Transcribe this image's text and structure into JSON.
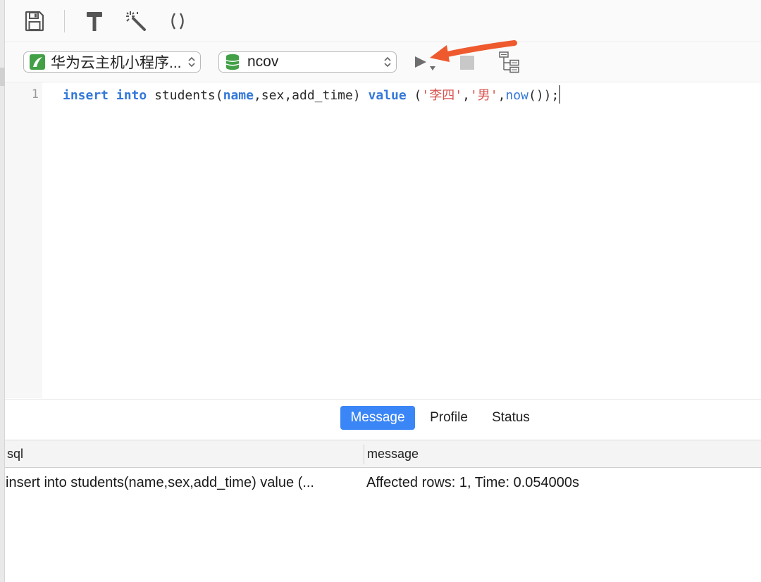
{
  "toolbar": {
    "icons": [
      "save-icon",
      "hammer-icon",
      "magic-wand-icon",
      "parentheses-icon"
    ]
  },
  "selectors": {
    "connection": "华为云主机小程序...",
    "database": "ncov"
  },
  "editor": {
    "line_number": "1",
    "code": {
      "t1": "insert",
      "t2": " ",
      "t3": "into",
      "t4": " students(",
      "t5": "name",
      "t6": ",sex,add_time) ",
      "t7": "value",
      "t8": " (",
      "t9": "'李四'",
      "t10": ",",
      "t11": "'男'",
      "t12": ",",
      "t13": "now",
      "t14": "());"
    }
  },
  "results": {
    "tabs": [
      "Message",
      "Profile",
      "Status"
    ],
    "active_tab": "Message",
    "columns": [
      "sql",
      "message"
    ],
    "rows": [
      {
        "sql": "insert into students(name,sex,add_time) value (...",
        "message": "Affected rows: 1, Time: 0.054000s"
      }
    ]
  },
  "colors": {
    "accent": "#3b86f7",
    "keyword": "#3478d9",
    "string": "#d9534f",
    "annotation_arrow": "#ee5a2e"
  }
}
